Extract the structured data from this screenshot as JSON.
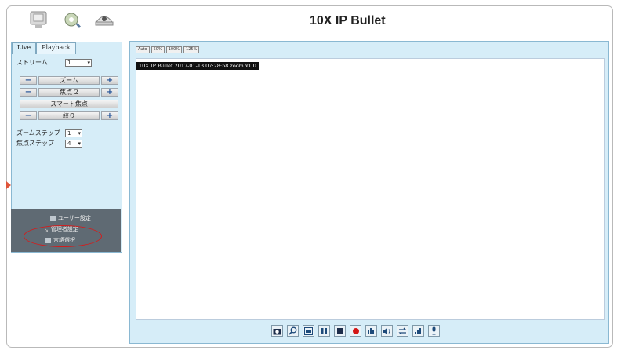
{
  "header": {
    "title": "10X IP Bullet",
    "icons": [
      "camera-monitor-icon",
      "settings-gear-icon",
      "dome-camera-icon"
    ]
  },
  "left_panel": {
    "tabs": [
      {
        "label": "Live",
        "active": true
      },
      {
        "label": "Playback",
        "active": false
      }
    ],
    "stream": {
      "label": "ストリーム",
      "value": "1"
    },
    "zoom": {
      "minus": "−",
      "label": "ズーム",
      "plus": "+"
    },
    "focus": {
      "minus": "−",
      "label": "焦点 2",
      "plus": "+"
    },
    "smart_focus": {
      "label": "スマート焦点"
    },
    "iris": {
      "minus": "−",
      "label": "絞り",
      "plus": "+"
    },
    "zoom_step": {
      "label": "ズームステップ",
      "value": "1"
    },
    "focus_step": {
      "label": "焦点ステップ",
      "value": "4"
    }
  },
  "settings_menu": {
    "items": [
      {
        "label": "ユーザー設定",
        "icon": "user-settings-icon"
      },
      {
        "label": "管理者設定",
        "icon": "admin-tools-icon"
      },
      {
        "label": "言語選択",
        "icon": "language-icon"
      }
    ],
    "highlight_color": "#d21d1d"
  },
  "video": {
    "osd_text": "10X IP Bullet 2017-01-13 07:28:58 zoom x1.0",
    "size_buttons": [
      "Auto",
      "50%",
      "100%",
      "125%"
    ]
  },
  "toolbar": {
    "icons": [
      "snapshot-icon",
      "digital-zoom-icon",
      "view-mode-icon",
      "pause-icon",
      "stop-icon",
      "record-icon",
      "audio-icon",
      "speaker-icon",
      "transfer-icon",
      "signal-icon",
      "microphone-icon"
    ]
  },
  "colors": {
    "panel_bg": "#d6edf8",
    "menu_bg": "#5f6a73",
    "accent_blue": "#1e4f96"
  }
}
